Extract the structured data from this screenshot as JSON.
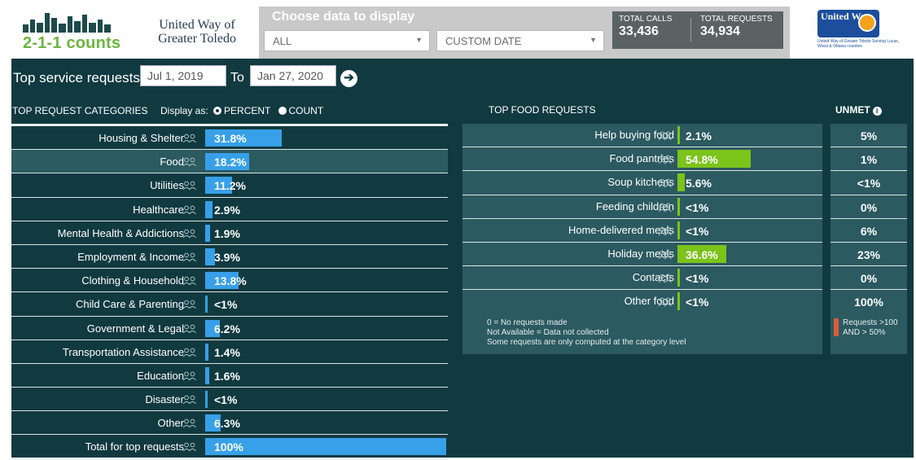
{
  "header": {
    "logo_text": "2-1-1 counts",
    "org_name": "United Way of Greater Toledo",
    "filter_title": "Choose data to display",
    "filter_category": "ALL",
    "filter_date": "CUSTOM DATE",
    "total_calls_label": "TOTAL CALLS",
    "total_calls": "33,436",
    "total_requests_label": "TOTAL REQUESTS",
    "total_requests": "34,934",
    "uw_logo_text": "United Way",
    "uw_tagline": "United Way of Greater Toledo Serving Lucas, Wood & Ottawa counties"
  },
  "toolbar": {
    "title": "Top service requests",
    "date_from": "Jul 1, 2019",
    "to_label": "To",
    "date_to": "Jan 27, 2020",
    "go_icon": "arrow-right-circle-icon"
  },
  "categories": {
    "heading": "TOP REQUEST CATEGORIES",
    "display_as": "Display as:",
    "opt_percent": "PERCENT",
    "opt_count": "COUNT",
    "selected": "PERCENT",
    "bar_color": "#37a0e8",
    "rows": [
      {
        "label": "Housing & Shelter",
        "value": "31.8%",
        "pct": 31.8
      },
      {
        "label": "Food",
        "value": "18.2%",
        "pct": 18.2
      },
      {
        "label": "Utilities",
        "value": "11.2%",
        "pct": 11.2
      },
      {
        "label": "Healthcare",
        "value": "2.9%",
        "pct": 2.9
      },
      {
        "label": "Mental Health & Addictions",
        "value": "1.9%",
        "pct": 1.9
      },
      {
        "label": "Employment & Income",
        "value": "3.9%",
        "pct": 3.9
      },
      {
        "label": "Clothing & Household",
        "value": "13.8%",
        "pct": 13.8
      },
      {
        "label": "Child Care & Parenting",
        "value": "<1%",
        "pct": 0.5
      },
      {
        "label": "Government & Legal",
        "value": "6.2%",
        "pct": 6.2
      },
      {
        "label": "Transportation Assistance",
        "value": "1.4%",
        "pct": 1.4
      },
      {
        "label": "Education",
        "value": "1.6%",
        "pct": 1.6
      },
      {
        "label": "Disaster",
        "value": "<1%",
        "pct": 0.5
      },
      {
        "label": "Other",
        "value": "6.3%",
        "pct": 6.3
      },
      {
        "label": "Total for top requests",
        "value": "100%",
        "pct": 100
      }
    ]
  },
  "food": {
    "heading": "TOP FOOD REQUESTS",
    "bar_color": "#7cc31a",
    "rows": [
      {
        "label": "Help buying food",
        "value": "2.1%",
        "pct": 2.1
      },
      {
        "label": "Food pantries",
        "value": "54.8%",
        "pct": 54.8
      },
      {
        "label": "Soup kitchens",
        "value": "5.6%",
        "pct": 5.6
      },
      {
        "label": "Feeding children",
        "value": "<1%",
        "pct": 0.5
      },
      {
        "label": "Home-delivered meals",
        "value": "<1%",
        "pct": 0.5
      },
      {
        "label": "Holiday meals",
        "value": "36.6%",
        "pct": 36.6
      },
      {
        "label": "Contacts",
        "value": "<1%",
        "pct": 0.5
      },
      {
        "label": "Other food",
        "value": "<1%",
        "pct": 0.5
      }
    ],
    "notes": [
      "0 = No requests made",
      "Not Available = Data not collected",
      "Some requests are only computed at the category level"
    ]
  },
  "unmet": {
    "heading": "UNMET",
    "values": [
      "5%",
      "1%",
      "<1%",
      "0%",
      "6%",
      "23%",
      "0%",
      "100%"
    ],
    "legend_color": "#dd5a3b",
    "legend_text": "Requests >100 AND > 50%"
  }
}
